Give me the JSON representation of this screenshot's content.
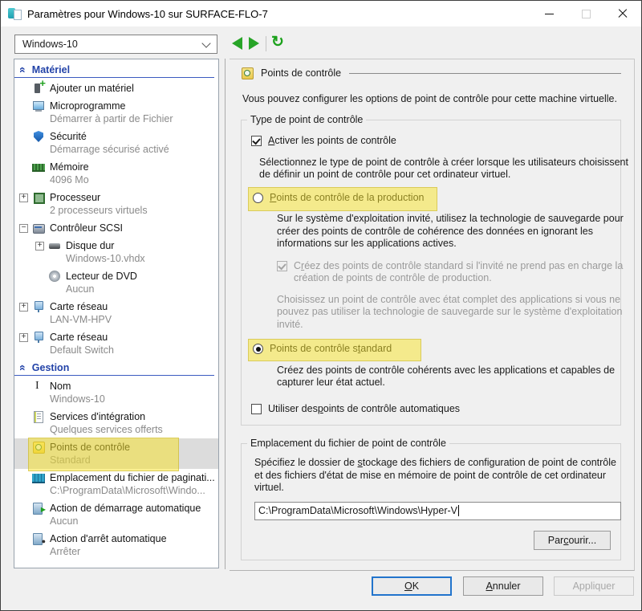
{
  "window": {
    "title": "Paramètres pour Windows-10 sur SURFACE-FLO-7"
  },
  "toolbar": {
    "vm_selector_value": "Windows-10"
  },
  "sidebar": {
    "sections": [
      {
        "title": "Matériel",
        "items": [
          {
            "id": "add-hardware",
            "icon": "add-hardware",
            "label": "Ajouter un matériel",
            "sub": null,
            "expander": null
          },
          {
            "id": "firmware",
            "icon": "firmware",
            "label": "Microprogramme",
            "sub": "Démarrer à partir de Fichier",
            "expander": null
          },
          {
            "id": "security",
            "icon": "security",
            "label": "Sécurité",
            "sub": "Démarrage sécurisé activé",
            "expander": null
          },
          {
            "id": "memory",
            "icon": "memory",
            "label": "Mémoire",
            "sub": "4096 Mo",
            "expander": null
          },
          {
            "id": "processor",
            "icon": "processor",
            "label": "Processeur",
            "sub": "2 processeurs virtuels",
            "expander": "+"
          },
          {
            "id": "scsi-controller",
            "icon": "scsi",
            "label": "Contrôleur SCSI",
            "sub": null,
            "expander": "-"
          },
          {
            "id": "hard-disk",
            "icon": "hard-disk",
            "label": "Disque dur",
            "sub": "Windows-10.vhdx",
            "expander": "+",
            "level": 2
          },
          {
            "id": "dvd-drive",
            "icon": "dvd",
            "label": "Lecteur de DVD",
            "sub": "Aucun",
            "expander": null,
            "level": 2
          },
          {
            "id": "network-adapter-1",
            "icon": "network",
            "label": "Carte réseau",
            "sub": "LAN-VM-HPV",
            "expander": "+"
          },
          {
            "id": "network-adapter-2",
            "icon": "network",
            "label": "Carte réseau",
            "sub": "Default Switch",
            "expander": "+"
          }
        ]
      },
      {
        "title": "Gestion",
        "items": [
          {
            "id": "name",
            "icon": "name",
            "label": "Nom",
            "sub": "Windows-10",
            "expander": null
          },
          {
            "id": "integration-services",
            "icon": "integration",
            "label": "Services d'intégration",
            "sub": "Quelques services offerts",
            "expander": null
          },
          {
            "id": "checkpoints",
            "icon": "checkpoint",
            "label": "Points de contrôle",
            "sub": "Standard",
            "expander": null,
            "selected": true,
            "highlighted": true
          },
          {
            "id": "pagefile-location",
            "icon": "pagefile",
            "label": "Emplacement du fichier de paginati...",
            "sub": "C:\\ProgramData\\Microsoft\\Windo...",
            "expander": null
          },
          {
            "id": "auto-start-action",
            "icon": "autostart",
            "label": "Action de démarrage automatique",
            "sub": "Aucun",
            "expander": null
          },
          {
            "id": "auto-stop-action",
            "icon": "autostop",
            "label": "Action d'arrêt automatique",
            "sub": "Arrêter",
            "expander": null
          }
        ]
      }
    ]
  },
  "panel": {
    "header": "Points de contrôle",
    "intro": "Vous pouvez configurer les options de point de contrôle pour cette machine virtuelle.",
    "group1": {
      "label": "Type de point de contrôle",
      "enable": {
        "pre": "",
        "key": "A",
        "post": "ctiver les points de contrôle",
        "checked": true
      },
      "select_desc": "Sélectionnez le type de point de contrôle à créer lorsque les utilisateurs choisissent de définir un point de contrôle pour cet ordinateur virtuel.",
      "production_radio": {
        "pre": "",
        "key": "P",
        "post": "oints de contrôle de la production",
        "selected": false
      },
      "production_desc": "Sur le système d'exploitation invité, utilisez la technologie de sauvegarde pour créer des points de contrôle de cohérence des données en ignorant les informations sur les applications actives.",
      "fallback_checkbox": {
        "pre": "C",
        "key": "r",
        "post": "éez des points de contrôle standard si l'invité ne prend pas en charge la création de points de contrôle de production.",
        "checked": true,
        "disabled": true
      },
      "complete_desc": "Choisissez un point de contrôle avec état complet des applications si vous ne pouvez pas utiliser la technologie de sauvegarde sur le système d'exploitation invité.",
      "standard_radio": {
        "pre": "Points de contrôle s",
        "key": "t",
        "post": "andard",
        "selected": true
      },
      "standard_desc": "Créez des points de contrôle cohérents avec les applications et capables de capturer leur état actuel.",
      "auto_checkbox": {
        "pre": "Utiliser des",
        "key": "p",
        "post": "oints de contrôle automatiques",
        "checked": false
      }
    },
    "group2": {
      "label": "Emplacement du fichier de point de contrôle",
      "desc": {
        "pre": "Spécifiez le dossier de ",
        "key": "s",
        "post": "tockage des fichiers de configuration de point de contrôle et des fichiers d'état de mise en mémoire de point de contrôle de cet ordinateur virtuel."
      },
      "path_value": "C:\\ProgramData\\Microsoft\\Windows\\Hyper-V",
      "browse_button": {
        "pre": "Par",
        "key": "c",
        "post": "ourir..."
      }
    }
  },
  "footer": {
    "ok": {
      "pre": "",
      "key": "O",
      "post": "K"
    },
    "cancel": {
      "pre": "",
      "key": "A",
      "post": "nnuler"
    },
    "apply": "Appliquer"
  },
  "colors": {
    "highlight_yellow": "#f2e233",
    "section_header_blue": "#2343a8",
    "nav_green": "#27a427",
    "selection_gray": "#dcdcdc",
    "default_button_border": "#2274cc",
    "titlebar_bg": "#ffffff",
    "dialog_bg": "#f0f0f0"
  }
}
